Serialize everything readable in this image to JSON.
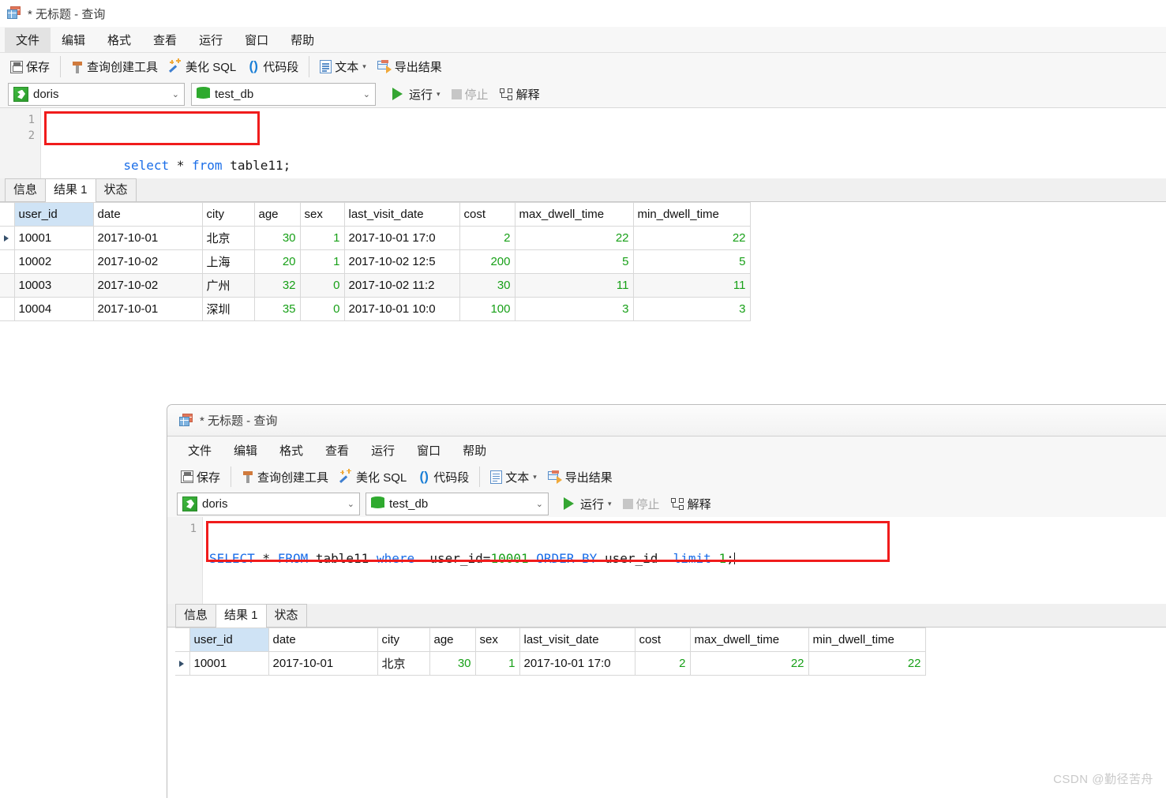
{
  "window1": {
    "title": "* 无标题 - 查询",
    "title_icon": "spreadsheet-icon",
    "menu": [
      "文件",
      "编辑",
      "格式",
      "查看",
      "运行",
      "窗口",
      "帮助"
    ],
    "menu_active": "文件",
    "toolbar": [
      {
        "label": "保存",
        "icon": "save-icon"
      },
      {
        "label": "查询创建工具",
        "icon": "hammer-icon"
      },
      {
        "label": "美化 SQL",
        "icon": "sparkle-wand-icon"
      },
      {
        "label": "代码段",
        "icon": "parentheses-icon"
      },
      {
        "label": "文本",
        "icon": "document-icon",
        "caret": "▾"
      },
      {
        "label": "导出结果",
        "icon": "export-grid-icon"
      }
    ],
    "connection": {
      "value": "doris",
      "icon": "dolphin-icon",
      "chevron": "⌄"
    },
    "database": {
      "value": "test_db",
      "icon": "database-icon",
      "chevron": "⌄"
    },
    "run_label": "运行",
    "run_caret": "▾",
    "stop_label": "停止",
    "explain_label": "解释",
    "editor": {
      "line_numbers": [
        "1",
        "2"
      ],
      "sql_tokens": [
        {
          "t": "select",
          "k": "kw"
        },
        {
          "t": " * ",
          "k": "pln"
        },
        {
          "t": "from",
          "k": "kw"
        },
        {
          "t": " table11;",
          "k": "pln"
        }
      ],
      "sql_plain": "select * from table11;"
    },
    "result_tabs": [
      "信息",
      "结果 1",
      "状态"
    ],
    "result_tab_selected": "结果 1",
    "grid": {
      "columns": [
        "user_id",
        "date",
        "city",
        "age",
        "sex",
        "last_visit_date",
        "cost",
        "max_dwell_time",
        "min_dwell_time"
      ],
      "selected_column": "user_id",
      "rows": [
        {
          "selected": true,
          "user_id": "10001",
          "date": "2017-10-01",
          "city": "北京",
          "age": "30",
          "sex": "1",
          "last_visit_date": "2017-10-01 17:0",
          "cost": "2",
          "max_dwell_time": "22",
          "min_dwell_time": "22"
        },
        {
          "selected": false,
          "user_id": "10002",
          "date": "2017-10-02",
          "city": "上海",
          "age": "20",
          "sex": "1",
          "last_visit_date": "2017-10-02 12:5",
          "cost": "200",
          "max_dwell_time": "5",
          "min_dwell_time": "5"
        },
        {
          "selected": false,
          "user_id": "10003",
          "date": "2017-10-02",
          "city": "广州",
          "age": "32",
          "sex": "0",
          "last_visit_date": "2017-10-02 11:2",
          "cost": "30",
          "max_dwell_time": "11",
          "min_dwell_time": "11"
        },
        {
          "selected": false,
          "user_id": "10004",
          "date": "2017-10-01",
          "city": "深圳",
          "age": "35",
          "sex": "0",
          "last_visit_date": "2017-10-01 10:0",
          "cost": "100",
          "max_dwell_time": "3",
          "min_dwell_time": "3"
        }
      ]
    }
  },
  "window2": {
    "title": "* 无标题 - 查询",
    "title_icon": "spreadsheet-icon",
    "menu": [
      "文件",
      "编辑",
      "格式",
      "查看",
      "运行",
      "窗口",
      "帮助"
    ],
    "toolbar": [
      {
        "label": "保存",
        "icon": "save-icon"
      },
      {
        "label": "查询创建工具",
        "icon": "hammer-icon"
      },
      {
        "label": "美化 SQL",
        "icon": "sparkle-wand-icon"
      },
      {
        "label": "代码段",
        "icon": "parentheses-icon"
      },
      {
        "label": "文本",
        "icon": "document-icon",
        "caret": "▾"
      },
      {
        "label": "导出结果",
        "icon": "export-grid-icon"
      }
    ],
    "connection": {
      "value": "doris",
      "icon": "dolphin-icon",
      "chevron": "⌄"
    },
    "database": {
      "value": "test_db",
      "icon": "database-icon",
      "chevron": "⌄"
    },
    "run_label": "运行",
    "run_caret": "▾",
    "stop_label": "停止",
    "explain_label": "解释",
    "editor": {
      "line_numbers": [
        "1"
      ],
      "sql_tokens": [
        {
          "t": "SELECT",
          "k": "kw"
        },
        {
          "t": " * ",
          "k": "pln"
        },
        {
          "t": "FROM",
          "k": "kw"
        },
        {
          "t": " table11 ",
          "k": "pln"
        },
        {
          "t": "where",
          "k": "kw"
        },
        {
          "t": "  user_id=",
          "k": "pln"
        },
        {
          "t": "10001",
          "k": "num"
        },
        {
          "t": " ",
          "k": "pln"
        },
        {
          "t": "ORDER BY",
          "k": "kw"
        },
        {
          "t": " user_id  ",
          "k": "pln"
        },
        {
          "t": "limit",
          "k": "kw"
        },
        {
          "t": " ",
          "k": "pln"
        },
        {
          "t": "1",
          "k": "num"
        },
        {
          "t": ";",
          "k": "pln"
        }
      ],
      "sql_plain": "SELECT * FROM table11 where  user_id=10001 ORDER BY user_id  limit 1;"
    },
    "result_tabs": [
      "信息",
      "结果 1",
      "状态"
    ],
    "result_tab_selected": "结果 1",
    "grid": {
      "columns": [
        "user_id",
        "date",
        "city",
        "age",
        "sex",
        "last_visit_date",
        "cost",
        "max_dwell_time",
        "min_dwell_time"
      ],
      "selected_column": "user_id",
      "rows": [
        {
          "selected": true,
          "user_id": "10001",
          "date": "2017-10-01",
          "city": "北京",
          "age": "30",
          "sex": "1",
          "last_visit_date": "2017-10-01 17:0",
          "cost": "2",
          "max_dwell_time": "22",
          "min_dwell_time": "22"
        }
      ]
    }
  },
  "watermark": "CSDN @勤径苦舟",
  "colors": {
    "keyword": "#1b6ee8",
    "number": "#18a018",
    "highlight_box": "#f01c1c",
    "selected_header": "#cfe3f5",
    "run_green": "#34a532"
  }
}
